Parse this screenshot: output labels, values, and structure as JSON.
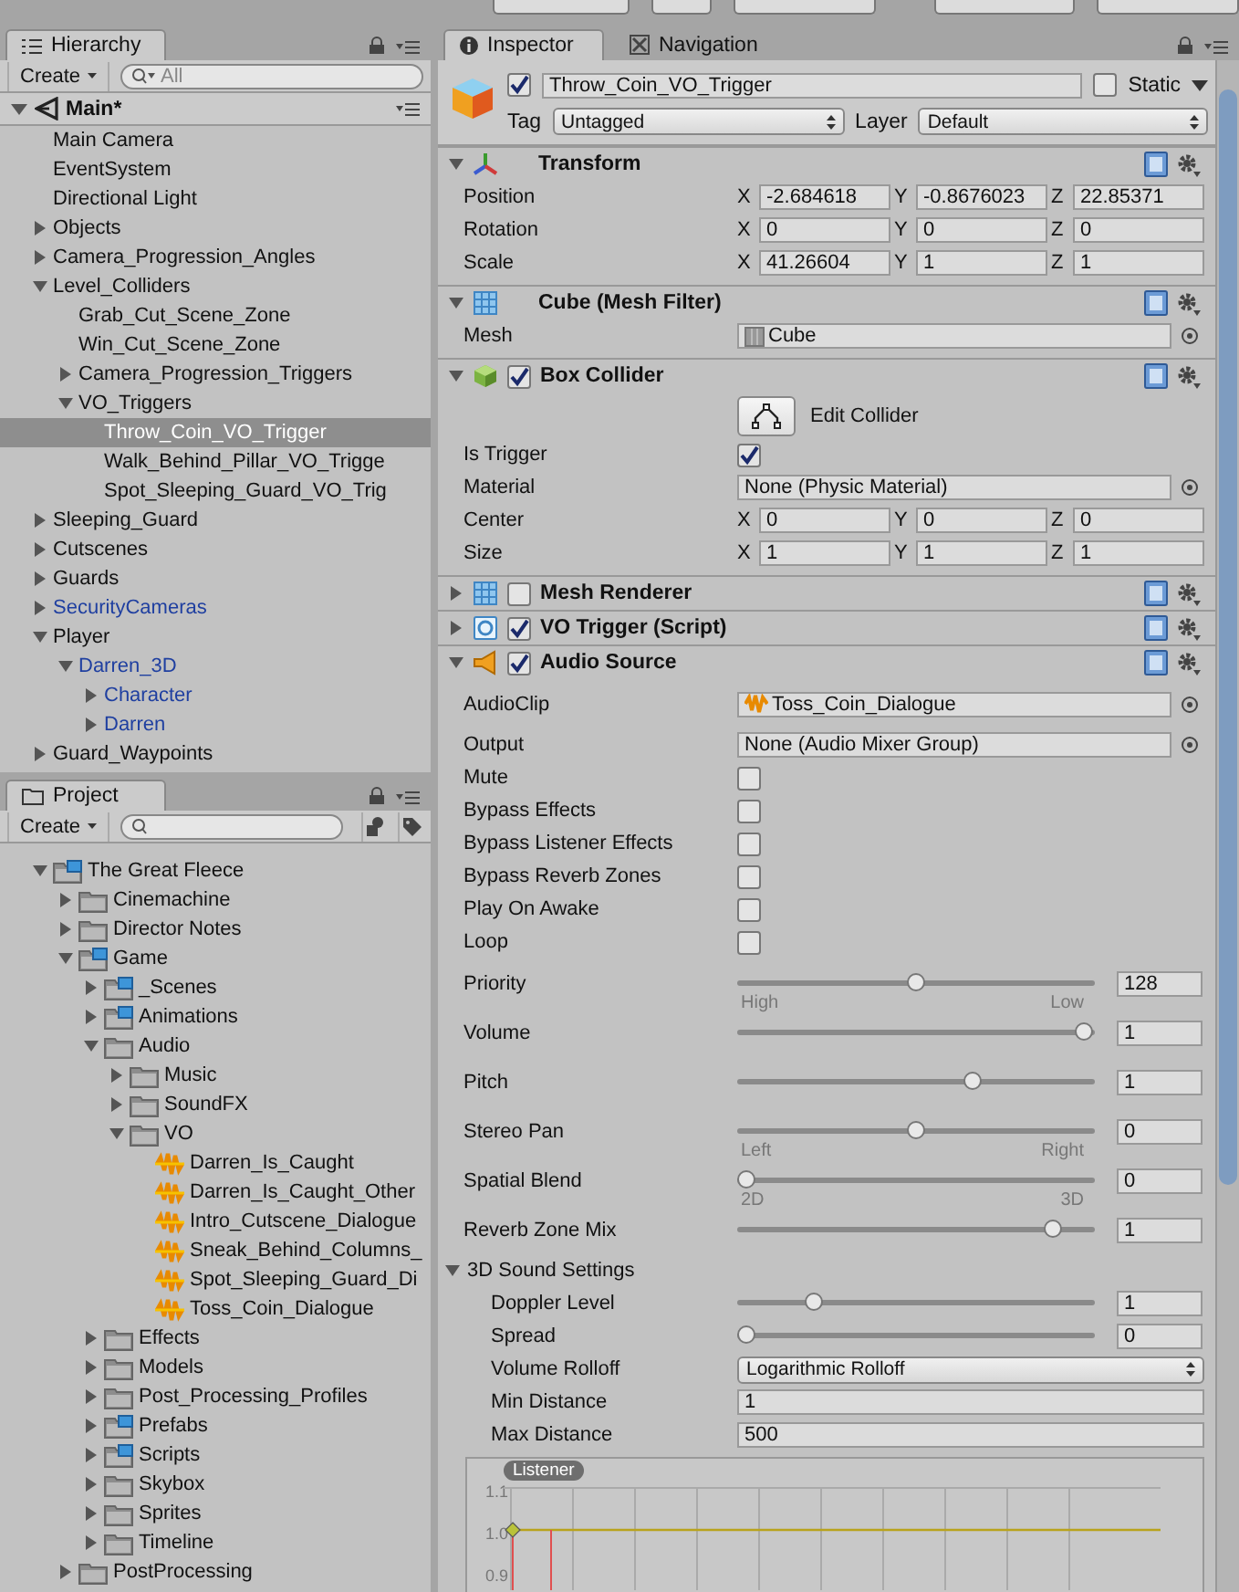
{
  "hierarchy": {
    "tab": "Hierarchy",
    "create": "Create",
    "search_placeholder": "All",
    "scene": "Main*",
    "items": [
      {
        "label": "Main Camera",
        "kind": "object",
        "selected": false
      },
      {
        "label": "EventSystem",
        "kind": "object",
        "selected": false
      },
      {
        "label": "Directional Light",
        "kind": "object",
        "selected": false
      },
      {
        "label": "Objects",
        "kind": "object",
        "selected": false,
        "expanded": false
      },
      {
        "label": "Camera_Progression_Angles",
        "kind": "object",
        "selected": false,
        "expanded": false
      },
      {
        "label": "Level_Colliders",
        "kind": "object",
        "selected": false,
        "expanded": true,
        "children": [
          {
            "label": "Grab_Cut_Scene_Zone",
            "kind": "object",
            "selected": false
          },
          {
            "label": "Win_Cut_Scene_Zone",
            "kind": "object",
            "selected": false
          },
          {
            "label": "Camera_Progression_Triggers",
            "kind": "object",
            "selected": false,
            "expanded": false
          },
          {
            "label": "VO_Triggers",
            "kind": "object",
            "selected": false,
            "expanded": true,
            "children": [
              {
                "label": "Throw_Coin_VO_Trigger",
                "kind": "object",
                "selected": true
              },
              {
                "label": "Walk_Behind_Pillar_VO_Trigge",
                "kind": "object",
                "selected": false
              },
              {
                "label": "Spot_Sleeping_Guard_VO_Trig",
                "kind": "object",
                "selected": false
              }
            ]
          }
        ]
      },
      {
        "label": "Sleeping_Guard",
        "kind": "object",
        "selected": false,
        "expanded": false
      },
      {
        "label": "Cutscenes",
        "kind": "object",
        "selected": false,
        "expanded": false
      },
      {
        "label": "Guards",
        "kind": "object",
        "selected": false,
        "expanded": false
      },
      {
        "label": "SecurityCameras",
        "kind": "prefab",
        "selected": false,
        "expanded": false
      },
      {
        "label": "Player",
        "kind": "object",
        "selected": false,
        "expanded": true,
        "children": [
          {
            "label": "Darren_3D",
            "kind": "prefab",
            "selected": false,
            "expanded": true,
            "children": [
              {
                "label": "Character",
                "kind": "prefab",
                "selected": false,
                "expanded": false
              },
              {
                "label": "Darren",
                "kind": "prefab",
                "selected": false,
                "expanded": false
              }
            ]
          }
        ]
      },
      {
        "label": "Guard_Waypoints",
        "kind": "object",
        "selected": false,
        "expanded": false
      }
    ]
  },
  "project": {
    "tab": "Project",
    "create": "Create",
    "items": [
      {
        "label": "The Great Fleece",
        "kind": "package",
        "selected": false,
        "expanded": true,
        "children": [
          {
            "label": "Cinemachine",
            "kind": "folder",
            "selected": false,
            "expanded": false
          },
          {
            "label": "Director Notes",
            "kind": "folder",
            "selected": false,
            "expanded": false
          },
          {
            "label": "Game",
            "kind": "package",
            "selected": false,
            "expanded": true,
            "children": [
              {
                "label": "_Scenes",
                "kind": "package",
                "selected": false,
                "expanded": false
              },
              {
                "label": "Animations",
                "kind": "package",
                "selected": false,
                "expanded": false
              },
              {
                "label": "Audio",
                "kind": "folder",
                "selected": false,
                "expanded": true,
                "children": [
                  {
                    "label": "Music",
                    "kind": "folder",
                    "selected": false,
                    "expanded": false
                  },
                  {
                    "label": "SoundFX",
                    "kind": "folder",
                    "selected": false,
                    "expanded": false
                  },
                  {
                    "label": "VO",
                    "kind": "folder",
                    "selected": false,
                    "expanded": true,
                    "children": [
                      {
                        "label": "Darren_Is_Caught",
                        "kind": "audio",
                        "selected": false
                      },
                      {
                        "label": "Darren_Is_Caught_Other",
                        "kind": "audio",
                        "selected": false
                      },
                      {
                        "label": "Intro_Cutscene_Dialogue",
                        "kind": "audio",
                        "selected": false
                      },
                      {
                        "label": "Sneak_Behind_Columns_",
                        "kind": "audio",
                        "selected": false
                      },
                      {
                        "label": "Spot_Sleeping_Guard_Di",
                        "kind": "audio",
                        "selected": false
                      },
                      {
                        "label": "Toss_Coin_Dialogue",
                        "kind": "audio",
                        "selected": false
                      }
                    ]
                  }
                ]
              },
              {
                "label": "Effects",
                "kind": "folder",
                "selected": false,
                "expanded": false
              },
              {
                "label": "Models",
                "kind": "folder",
                "selected": false,
                "expanded": false
              },
              {
                "label": "Post_Processing_Profiles",
                "kind": "folder",
                "selected": false,
                "expanded": false
              },
              {
                "label": "Prefabs",
                "kind": "package",
                "selected": false,
                "expanded": false
              },
              {
                "label": "Scripts",
                "kind": "package",
                "selected": false,
                "expanded": false
              },
              {
                "label": "Skybox",
                "kind": "folder",
                "selected": false,
                "expanded": false
              },
              {
                "label": "Sprites",
                "kind": "folder",
                "selected": false,
                "expanded": false
              },
              {
                "label": "Timeline",
                "kind": "folder",
                "selected": false,
                "expanded": false
              }
            ]
          },
          {
            "label": "PostProcessing",
            "kind": "folder",
            "selected": false,
            "expanded": false
          }
        ]
      }
    ]
  },
  "inspector": {
    "tabs": [
      {
        "label": "Inspector",
        "kind": "info",
        "selected": true
      },
      {
        "label": "Navigation",
        "kind": "navigation",
        "selected": false
      }
    ],
    "object": {
      "active": true,
      "name": "Throw_Coin_VO_Trigger",
      "static": false,
      "static_label": "Static",
      "tag_label": "Tag",
      "tag": "Untagged",
      "layer_label": "Layer",
      "layer": "Default"
    },
    "components": [
      {
        "kind": "transform",
        "title": "Transform",
        "expanded": true,
        "rows": [
          {
            "kind": "vector3",
            "label": "Position",
            "axes": [
              {
                "axis": "X",
                "value": "-2.684618"
              },
              {
                "axis": "Y",
                "value": "-0.8676023"
              },
              {
                "axis": "Z",
                "value": "22.85371"
              }
            ]
          },
          {
            "kind": "vector3",
            "label": "Rotation",
            "axes": [
              {
                "axis": "X",
                "value": "0"
              },
              {
                "axis": "Y",
                "value": "0"
              },
              {
                "axis": "Z",
                "value": "0"
              }
            ]
          },
          {
            "kind": "vector3",
            "label": "Scale",
            "axes": [
              {
                "axis": "X",
                "value": "41.26604"
              },
              {
                "axis": "Y",
                "value": "1"
              },
              {
                "axis": "Z",
                "value": "1"
              }
            ]
          }
        ]
      },
      {
        "kind": "mesh-filter",
        "title": "Cube (Mesh Filter)",
        "expanded": true,
        "rows": [
          {
            "kind": "mesh-ref",
            "label": "Mesh",
            "value": "Cube"
          }
        ]
      },
      {
        "kind": "box-collider",
        "title": "Box Collider",
        "enabled": true,
        "expanded": true,
        "rows": [
          {
            "kind": "edit-button",
            "label": "Edit Collider"
          },
          {
            "kind": "checkbox",
            "label": "Is Trigger",
            "checked": true
          },
          {
            "kind": "ref",
            "label": "Material",
            "value": "None (Physic Material)"
          },
          {
            "kind": "vector3",
            "label": "Center",
            "axes": [
              {
                "axis": "X",
                "value": "0"
              },
              {
                "axis": "Y",
                "value": "0"
              },
              {
                "axis": "Z",
                "value": "0"
              }
            ]
          },
          {
            "kind": "vector3",
            "label": "Size",
            "axes": [
              {
                "axis": "X",
                "value": "1"
              },
              {
                "axis": "Y",
                "value": "1"
              },
              {
                "axis": "Z",
                "value": "1"
              }
            ]
          }
        ]
      },
      {
        "kind": "mesh-renderer",
        "title": "Mesh Renderer",
        "enabled": false,
        "expanded": false
      },
      {
        "kind": "script",
        "title": "VO Trigger (Script)",
        "enabled": true,
        "expanded": false
      },
      {
        "kind": "audio-source",
        "title": "Audio Source",
        "enabled": true,
        "expanded": true,
        "rows": [
          {
            "kind": "clip-ref",
            "label": "AudioClip",
            "value": "Toss_Coin_Dialogue"
          },
          {
            "kind": "ref",
            "label": "Output",
            "value": "None (Audio Mixer Group)"
          },
          {
            "kind": "checkbox",
            "label": "Mute",
            "checked": false
          },
          {
            "kind": "checkbox",
            "label": "Bypass Effects",
            "checked": false
          },
          {
            "kind": "checkbox",
            "label": "Bypass Listener Effects",
            "checked": false
          },
          {
            "kind": "checkbox",
            "label": "Bypass Reverb Zones",
            "checked": false
          },
          {
            "kind": "checkbox",
            "label": "Play On Awake",
            "checked": false
          },
          {
            "kind": "checkbox",
            "label": "Loop",
            "checked": false
          },
          {
            "kind": "slider",
            "label": "Priority",
            "level": 0.5,
            "value": "128",
            "ends": [
              "High",
              "Low"
            ]
          },
          {
            "kind": "slider",
            "label": "Volume",
            "level": 1,
            "value": "1"
          },
          {
            "kind": "slider",
            "label": "Pitch",
            "level": 0.67,
            "value": "1"
          },
          {
            "kind": "slider",
            "label": "Stereo Pan",
            "level": 0.5,
            "value": "0",
            "ends": [
              "Left",
              "Right"
            ]
          },
          {
            "kind": "slider",
            "label": "Spatial Blend",
            "level": 0,
            "value": "0",
            "ends": [
              "2D",
              "3D"
            ]
          },
          {
            "kind": "slider",
            "label": "Reverb Zone Mix",
            "level": 0.91,
            "value": "1"
          },
          {
            "kind": "section",
            "label": "3D Sound Settings",
            "expanded": true,
            "children": [
              {
                "kind": "slider",
                "label": "Doppler Level",
                "level": 0.2,
                "value": "1"
              },
              {
                "kind": "slider",
                "label": "Spread",
                "level": 0,
                "value": "0"
              },
              {
                "kind": "dropdown",
                "label": "Volume Rolloff",
                "value": "Logarithmic Rolloff"
              },
              {
                "kind": "number",
                "label": "Min Distance",
                "value": "1"
              },
              {
                "kind": "number",
                "label": "Max Distance",
                "value": "500"
              },
              {
                "kind": "curve-graph",
                "badge": "Listener",
                "ticks": [
                  "1.1",
                  "1.0",
                  "0.9"
                ]
              }
            ]
          }
        ]
      }
    ]
  }
}
